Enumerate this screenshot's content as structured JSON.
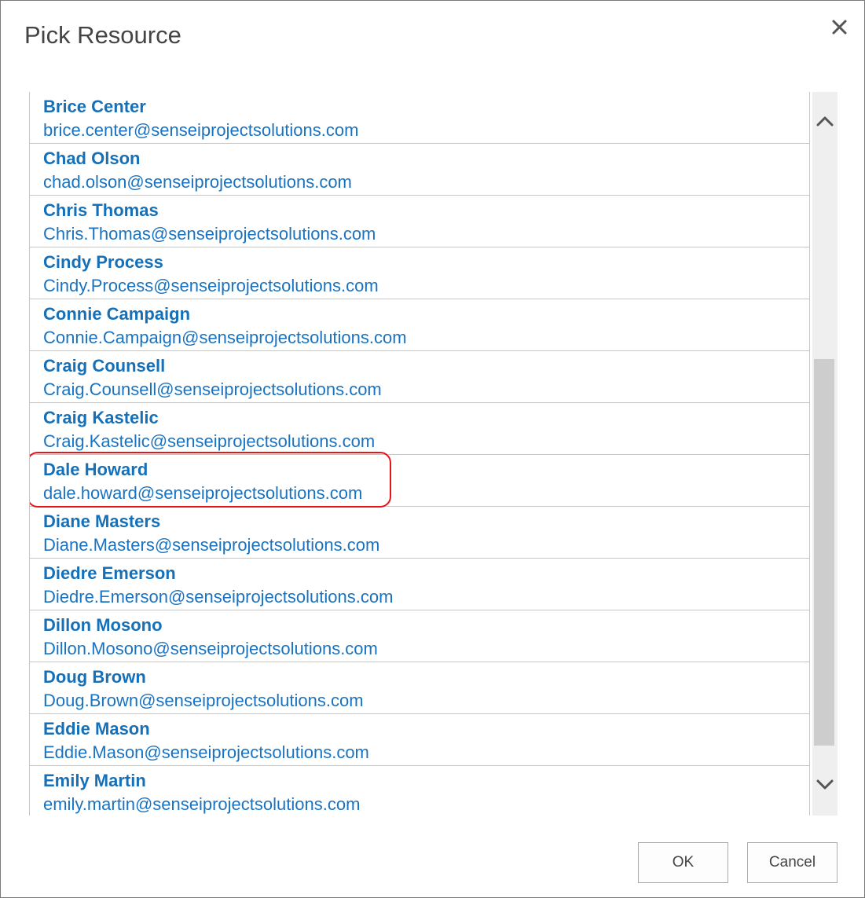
{
  "dialog": {
    "title": "Pick Resource"
  },
  "resources": [
    {
      "name": "Brice Center",
      "email": "brice.center@senseiprojectsolutions.com"
    },
    {
      "name": "Chad Olson",
      "email": "chad.olson@senseiprojectsolutions.com"
    },
    {
      "name": "Chris Thomas",
      "email": "Chris.Thomas@senseiprojectsolutions.com"
    },
    {
      "name": "Cindy Process",
      "email": "Cindy.Process@senseiprojectsolutions.com"
    },
    {
      "name": "Connie Campaign",
      "email": "Connie.Campaign@senseiprojectsolutions.com"
    },
    {
      "name": "Craig Counsell",
      "email": "Craig.Counsell@senseiprojectsolutions.com"
    },
    {
      "name": "Craig Kastelic",
      "email": "Craig.Kastelic@senseiprojectsolutions.com"
    },
    {
      "name": "Dale Howard",
      "email": "dale.howard@senseiprojectsolutions.com"
    },
    {
      "name": "Diane Masters",
      "email": "Diane.Masters@senseiprojectsolutions.com"
    },
    {
      "name": "Diedre Emerson",
      "email": "Diedre.Emerson@senseiprojectsolutions.com"
    },
    {
      "name": "Dillon Mosono",
      "email": "Dillon.Mosono@senseiprojectsolutions.com"
    },
    {
      "name": "Doug Brown",
      "email": "Doug.Brown@senseiprojectsolutions.com"
    },
    {
      "name": "Eddie Mason",
      "email": "Eddie.Mason@senseiprojectsolutions.com"
    },
    {
      "name": "Emily Martin",
      "email": "emily.martin@senseiprojectsolutions.com"
    }
  ],
  "highlighted_resource": "Dale Howard",
  "buttons": {
    "ok": "OK",
    "cancel": "Cancel"
  },
  "colors": {
    "link": "#1570b8",
    "highlight": "#e8141c"
  },
  "icons": {
    "close": "close-icon",
    "scroll_up": "chevron-up-icon",
    "scroll_down": "chevron-down-icon"
  }
}
